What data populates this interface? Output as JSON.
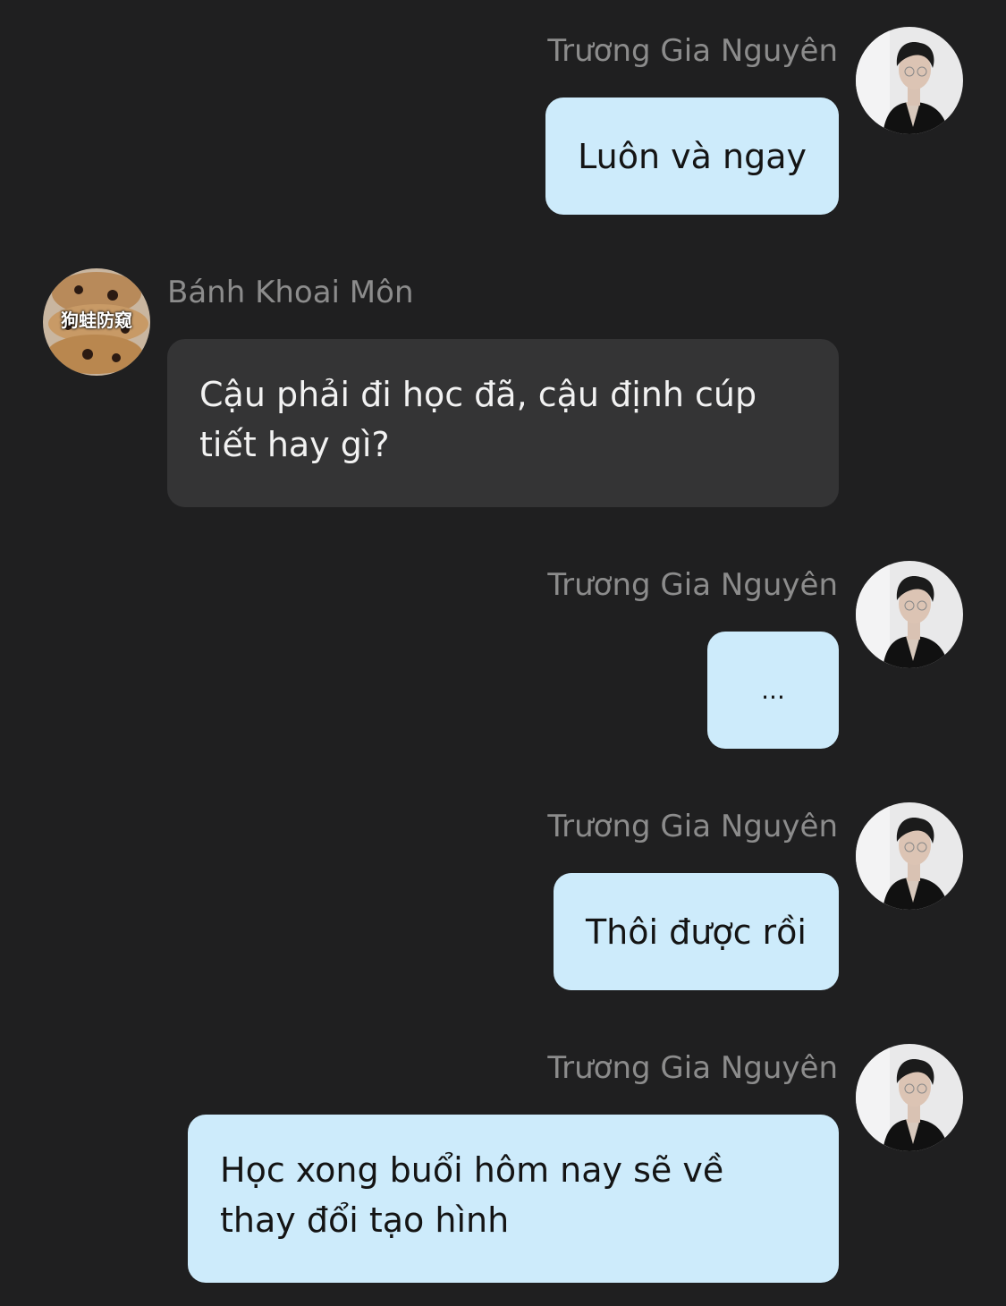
{
  "messages": [
    {
      "sender": "Trương Gia Nguyên",
      "text": "Luôn và ngay",
      "mine": true
    },
    {
      "sender": "Bánh Khoai Môn",
      "text": "Cậu phải đi học đã, cậu định cúp tiết hay gì?",
      "mine": false,
      "avatar_text": "狗蛙防窥"
    },
    {
      "sender": "Trương Gia Nguyên",
      "text": "...",
      "mine": true
    },
    {
      "sender": "Trương Gia Nguyên",
      "text": "Thôi được rồi",
      "mine": true
    },
    {
      "sender": "Trương Gia Nguyên",
      "text": "Học xong buổi hôm nay sẽ về thay đổi tạo hình",
      "mine": true
    }
  ],
  "colors": {
    "background": "#1f1f20",
    "my_bubble": "#cdebfb",
    "other_bubble": "#343435",
    "sender_name": "#8c8c8c"
  },
  "icons": {
    "my_avatar": "user-avatar-photo",
    "other_avatar": "cookie-pastry-avatar-photo"
  }
}
